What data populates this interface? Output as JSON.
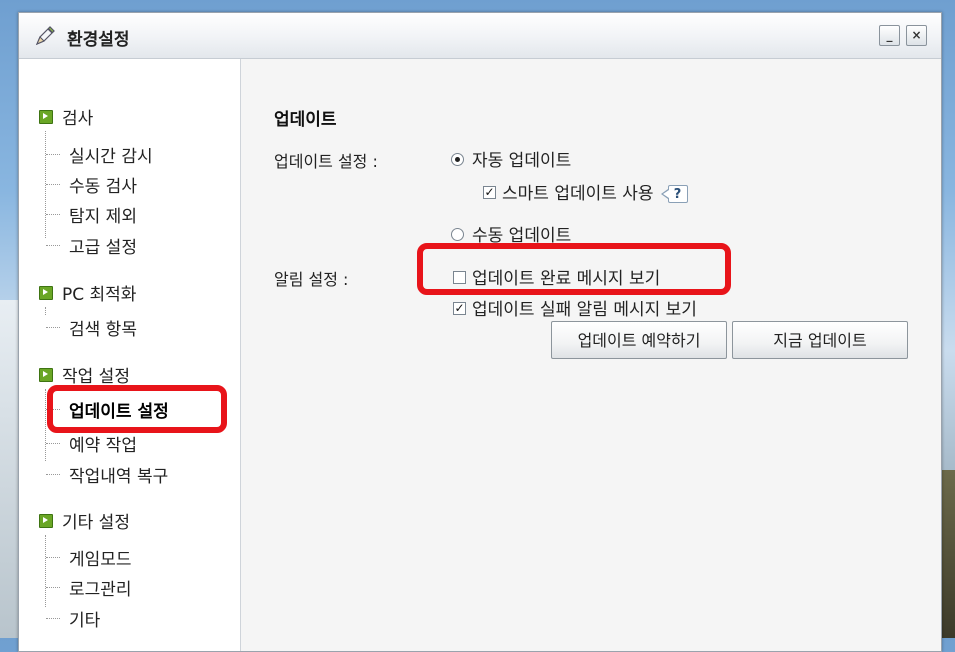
{
  "window": {
    "title": "환경설정",
    "minimize_label": "_",
    "close_label": "×"
  },
  "sidebar": {
    "categories": [
      {
        "label": "검사",
        "items": [
          "실시간 감시",
          "수동 검사",
          "탐지 제외",
          "고급 설정"
        ]
      },
      {
        "label": "PC 최적화",
        "items": [
          "검색 항목"
        ]
      },
      {
        "label": "작업 설정",
        "items": [
          "업데이트 설정",
          "예약 작업",
          "작업내역 복구"
        ]
      },
      {
        "label": "기타 설정",
        "items": [
          "게임모드",
          "로그관리",
          "기타"
        ]
      }
    ],
    "active_item": "업데이트 설정"
  },
  "main": {
    "section_title": "업데이트",
    "update_setting": {
      "label": "업데이트 설정 :",
      "auto_update": {
        "label": "자동 업데이트",
        "selected": true
      },
      "smart_update": {
        "label": "스마트 업데이트 사용",
        "checked": true,
        "help": "?"
      },
      "manual_update": {
        "label": "수동 업데이트",
        "selected": false
      }
    },
    "alert_setting": {
      "label": "알림 설정 :",
      "show_complete": {
        "label": "업데이트 완료 메시지 보기",
        "checked": false
      },
      "show_failure": {
        "label": "업데이트 실패 알림 메시지 보기",
        "checked": true
      }
    },
    "buttons": {
      "schedule": "업데이트 예약하기",
      "now": "지금 업데이트"
    }
  },
  "colors": {
    "highlight": "#e8141a",
    "bullet": "#6aa625",
    "content_bg": "#f5f5f5"
  },
  "icons": {
    "title": "pencil-icon",
    "category_bullet": "green-arrow-icon"
  }
}
